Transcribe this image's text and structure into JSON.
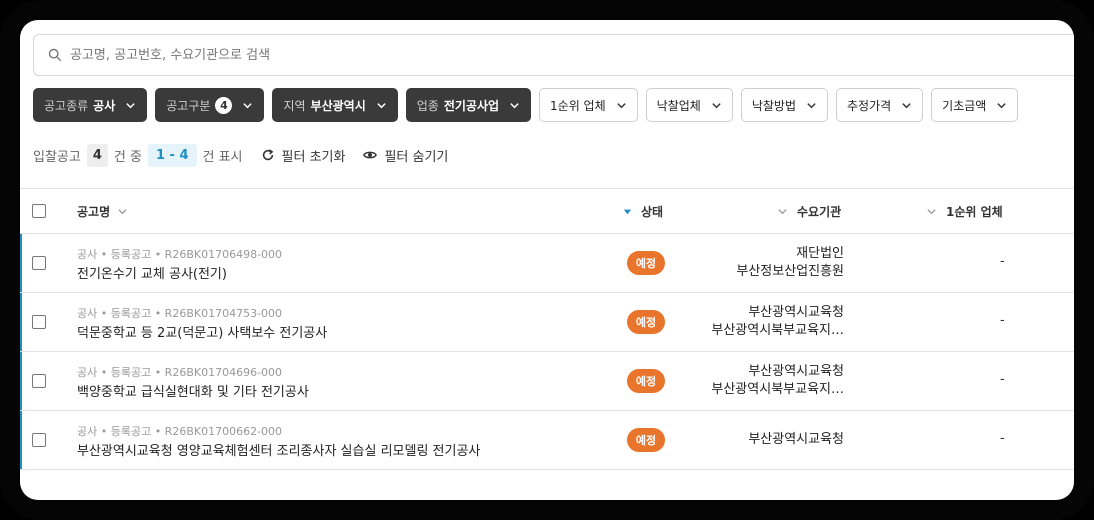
{
  "search": {
    "placeholder": "공고명, 공고번호, 수요기관으로 검색"
  },
  "filters": [
    {
      "label": "공고종류",
      "value": "공사",
      "style": "dark"
    },
    {
      "label": "공고구분",
      "count": "4",
      "style": "dark"
    },
    {
      "label": "지역",
      "value": "부산광역시",
      "style": "dark"
    },
    {
      "label": "업종",
      "value": "전기공사업",
      "style": "dark"
    },
    {
      "label": "1순위 업체",
      "style": "light"
    },
    {
      "label": "낙찰업체",
      "style": "light"
    },
    {
      "label": "낙찰방법",
      "style": "light"
    },
    {
      "label": "추정가격",
      "style": "light"
    },
    {
      "label": "기초금액",
      "style": "light"
    }
  ],
  "summary": {
    "prefix": "입찰공고",
    "total": "4",
    "middle": "건 중",
    "range": "1 - 4",
    "suffix": "건 표시",
    "reset_label": "필터 초기화",
    "hide_label": "필터 숨기기"
  },
  "columns": {
    "name": "공고명",
    "status": "상태",
    "agency": "수요기관",
    "first": "1순위 업체"
  },
  "rows": [
    {
      "meta": "공사 • 등록공고 • R26BK01706498-000",
      "title": "전기온수기 교체 공사(전기)",
      "status": "예정",
      "agency_line1": "재단법인",
      "agency_line2": "부산정보산업진흥원",
      "first": "-"
    },
    {
      "meta": "공사 • 등록공고 • R26BK01704753-000",
      "title": "덕문중학교 등 2교(덕문고) 사택보수 전기공사",
      "status": "예정",
      "agency_line1": "부산광역시교육청",
      "agency_line2": "부산광역시북부교육지…",
      "first": "-"
    },
    {
      "meta": "공사 • 등록공고 • R26BK01704696-000",
      "title": "백양중학교 급식실현대화 및 기타 전기공사",
      "status": "예정",
      "agency_line1": "부산광역시교육청",
      "agency_line2": "부산광역시북부교육지…",
      "first": "-"
    },
    {
      "meta": "공사 • 등록공고 • R26BK01700662-000",
      "title": "부산광역시교육청 영양교육체험센터 조리종사자 실습실 리모델링 전기공사",
      "status": "예정",
      "agency_line1": "부산광역시교육청",
      "agency_line2": "",
      "first": "-"
    }
  ],
  "colors": {
    "accent": "#1d8fc7",
    "status_badge": "#e9742b",
    "dark_chip": "#3a3a3a"
  }
}
